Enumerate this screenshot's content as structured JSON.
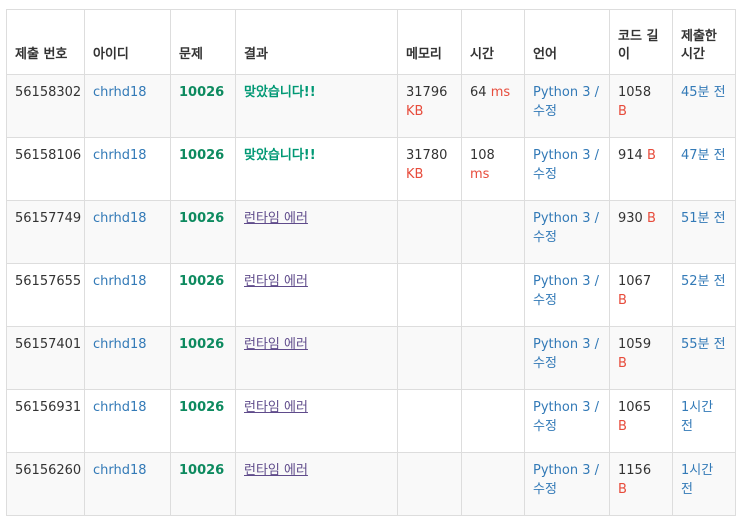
{
  "headers": {
    "submission_id": "제출 번호",
    "user": "아이디",
    "problem": "문제",
    "result": "결과",
    "memory": "메모리",
    "time": "시간",
    "language": "언어",
    "code_length": "코드 길이",
    "submitted": "제출한 시간"
  },
  "units": {
    "kb": "KB",
    "ms": "ms",
    "b": "B"
  },
  "rows": [
    {
      "id": "56158302",
      "user": "chrhd18",
      "problem": "10026",
      "result": "맞았습니다!!",
      "status": "accepted",
      "memory": "31796",
      "time": "64",
      "lang": "Python 3",
      "lang_sep": " / ",
      "edit": "수정",
      "length": "1058",
      "ago": "45분 전"
    },
    {
      "id": "56158106",
      "user": "chrhd18",
      "problem": "10026",
      "result": "맞았습니다!!",
      "status": "accepted",
      "memory": "31780",
      "time": "108",
      "lang": "Python 3",
      "lang_sep": " / ",
      "edit": "수정",
      "length": "914",
      "ago": "47분 전"
    },
    {
      "id": "56157749",
      "user": "chrhd18",
      "problem": "10026",
      "result": "런타임 에러",
      "status": "runtime-error",
      "memory": "",
      "time": "",
      "lang": "Python 3",
      "lang_sep": " / ",
      "edit": "수정",
      "length": "930",
      "ago": "51분 전"
    },
    {
      "id": "56157655",
      "user": "chrhd18",
      "problem": "10026",
      "result": "런타임 에러",
      "status": "runtime-error",
      "memory": "",
      "time": "",
      "lang": "Python 3",
      "lang_sep": " / ",
      "edit": "수정",
      "length": "1067",
      "ago": "52분 전"
    },
    {
      "id": "56157401",
      "user": "chrhd18",
      "problem": "10026",
      "result": "런타임 에러",
      "status": "runtime-error",
      "memory": "",
      "time": "",
      "lang": "Python 3",
      "lang_sep": " / ",
      "edit": "수정",
      "length": "1059",
      "ago": "55분 전"
    },
    {
      "id": "56156931",
      "user": "chrhd18",
      "problem": "10026",
      "result": "런타임 에러",
      "status": "runtime-error",
      "memory": "",
      "time": "",
      "lang": "Python 3",
      "lang_sep": " / ",
      "edit": "수정",
      "length": "1065",
      "ago": "1시간 전"
    },
    {
      "id": "56156260",
      "user": "chrhd18",
      "problem": "10026",
      "result": "런타임 에러",
      "status": "runtime-error",
      "memory": "",
      "time": "",
      "lang": "Python 3",
      "lang_sep": " / ",
      "edit": "수정",
      "length": "1156",
      "ago": "1시간 전"
    }
  ],
  "colors": {
    "link": "#337ab7",
    "accepted": "#009874",
    "problem": "#0d8a5f",
    "runtime_error": "#5f4b8b",
    "unit": "#e74c3c",
    "border": "#dddddd",
    "stripe": "#f9f9f9"
  }
}
